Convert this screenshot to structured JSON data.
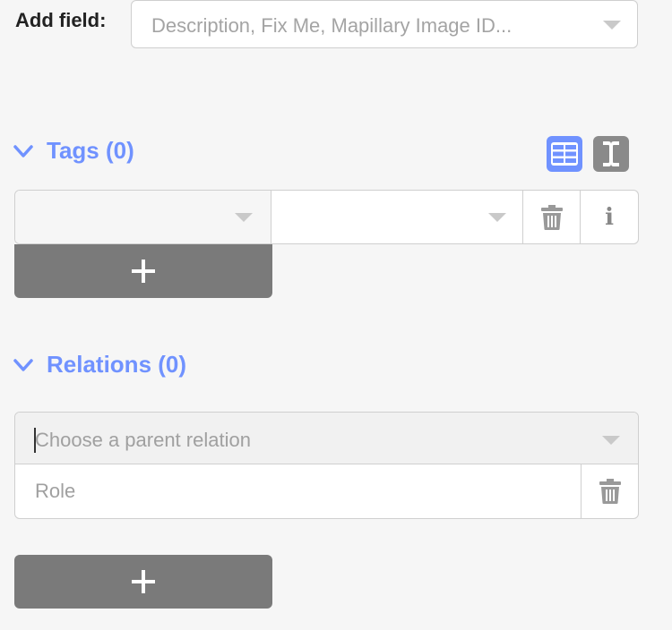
{
  "add_field": {
    "label": "Add field:",
    "placeholder": "Description, Fix Me, Mapillary Image ID..."
  },
  "tags_section": {
    "title": "Tags (0)",
    "view_modes": [
      "list-view-icon",
      "text-view-icon"
    ],
    "active_view": "list-view-icon",
    "rows": [
      {
        "key": "",
        "value": ""
      }
    ],
    "info_glyph": "i",
    "add_glyph": "+"
  },
  "relations_section": {
    "title": "Relations (0)",
    "parent_placeholder": "Choose a parent relation",
    "role_placeholder": "Role",
    "add_glyph": "+"
  },
  "colors": {
    "accent": "#7092ff",
    "button_gray": "#7a7a7a",
    "background": "#f6f6f6"
  }
}
